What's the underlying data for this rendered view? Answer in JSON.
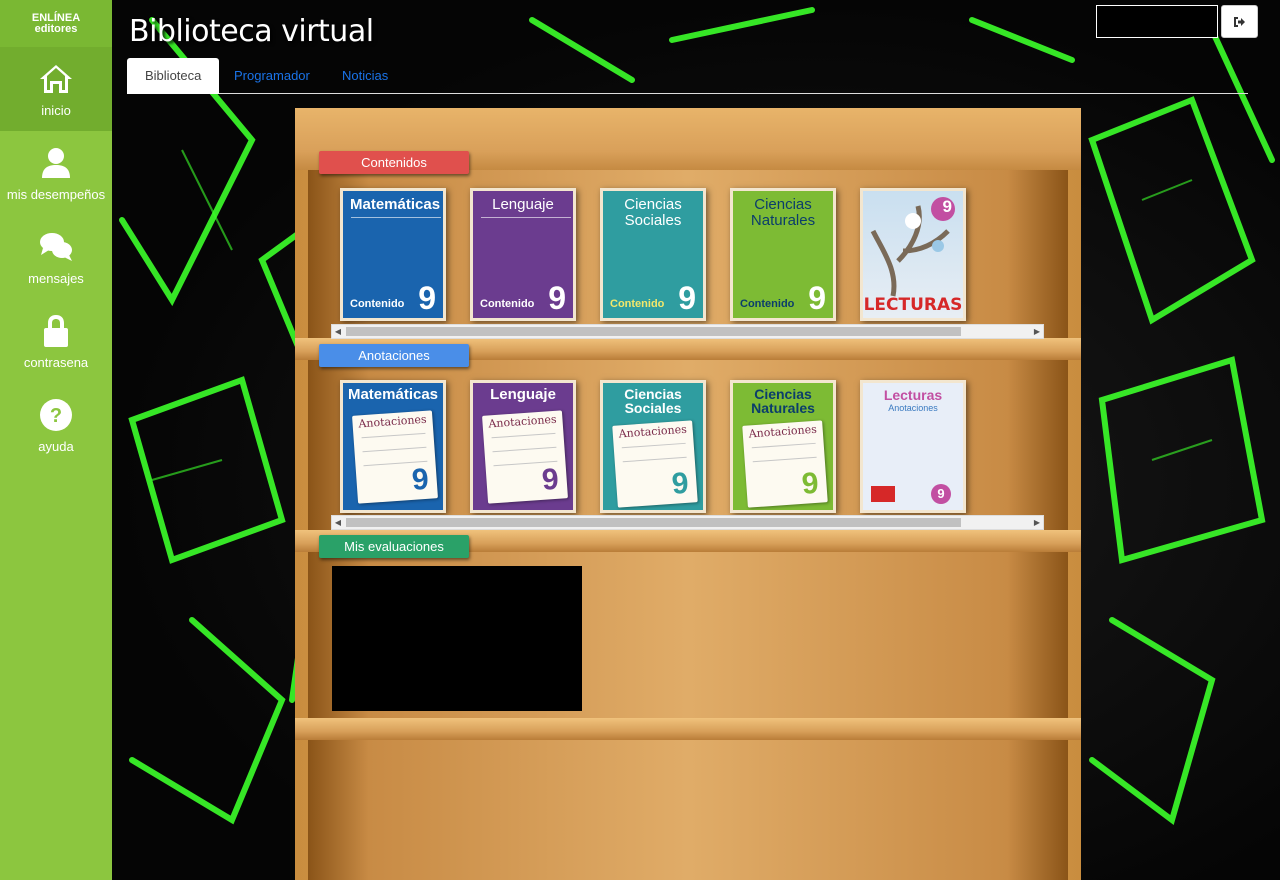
{
  "brand": {
    "line1": "ENLÍNEA",
    "line2": "editores"
  },
  "sidebar": {
    "items": [
      {
        "label": "inicio",
        "icon": "home-icon"
      },
      {
        "label": "mis desempeños",
        "icon": "user-icon"
      },
      {
        "label": "mensajes",
        "icon": "chat-icon"
      },
      {
        "label": "contrasena",
        "icon": "lock-icon"
      },
      {
        "label": "ayuda",
        "icon": "help-icon"
      }
    ]
  },
  "header": {
    "title": "Biblioteca virtual"
  },
  "tabs": [
    {
      "label": "Biblioteca"
    },
    {
      "label": "Programador"
    },
    {
      "label": "Noticias"
    }
  ],
  "sections": {
    "contenidos": {
      "label": "Contenidos",
      "color": "#e0504d",
      "books": [
        {
          "title": "Matemáticas",
          "subtitle": "Contenido",
          "grade": "9",
          "color": "#1a64ae"
        },
        {
          "title": "Lenguaje",
          "subtitle": "Contenido",
          "grade": "9",
          "color": "#6b3c8f"
        },
        {
          "title": "Ciencias Sociales",
          "subtitle": "Contenido",
          "grade": "9",
          "color": "#2f9da0"
        },
        {
          "title": "Ciencias Naturales",
          "subtitle": "Contenido",
          "grade": "9",
          "color": "#7dbb34"
        },
        {
          "title": "LECTURAS",
          "grade": "9",
          "color": "#c9dff0"
        }
      ]
    },
    "anotaciones": {
      "label": "Anotaciones",
      "color": "#4a8ee8",
      "books": [
        {
          "title": "Matemáticas",
          "note": "Anotaciones",
          "grade": "9",
          "color": "#1a64ae"
        },
        {
          "title": "Lenguaje",
          "note": "Anotaciones",
          "grade": "9",
          "color": "#6b3c8f"
        },
        {
          "title": "Ciencias Sociales",
          "note": "Anotaciones",
          "grade": "9",
          "color": "#2f9da0"
        },
        {
          "title": "Ciencias Naturales",
          "note": "Anotaciones",
          "grade": "9",
          "color": "#7dbb34"
        },
        {
          "title": "Lecturas",
          "note": "Anotaciones",
          "grade": "9",
          "color": "#e8eef8"
        }
      ]
    },
    "evaluaciones": {
      "label": "Mis evaluaciones",
      "color": "#2aa168"
    }
  },
  "colors": {
    "sidebar": "#8cc63f",
    "accent_green": "#39ff14",
    "tab_link": "#1a73e8"
  }
}
